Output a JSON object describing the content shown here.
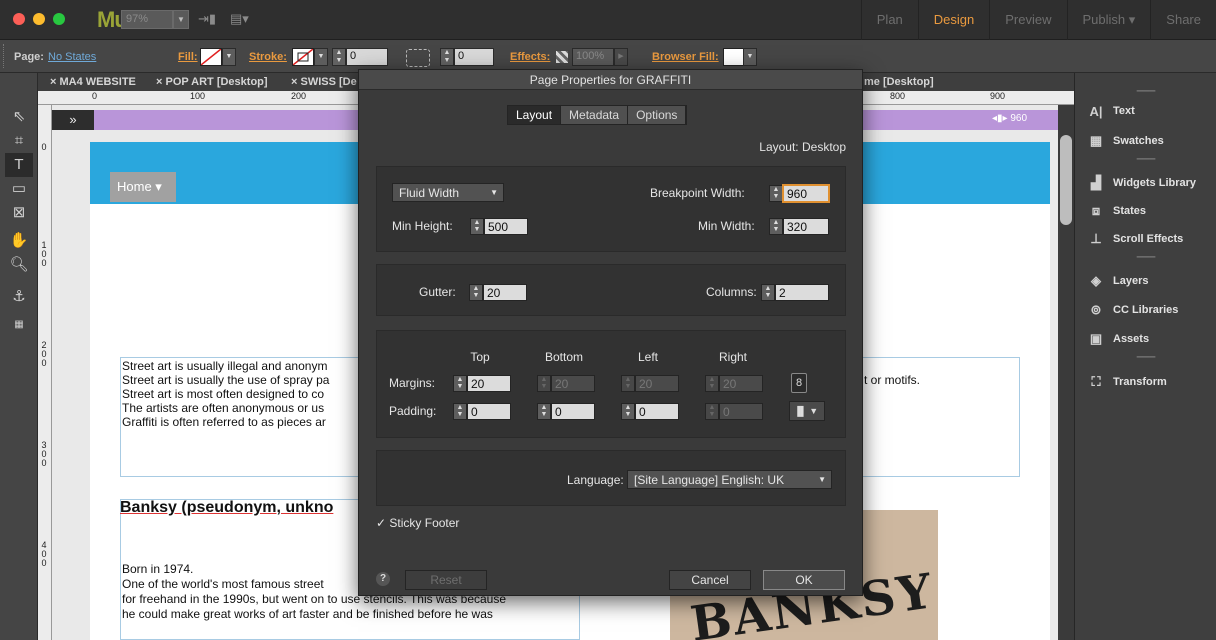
{
  "app": {
    "logo": "Mu",
    "zoom": "97%",
    "modes": [
      "Plan",
      "Design",
      "Preview",
      "Publish ▾",
      "Share"
    ]
  },
  "controlbar": {
    "page_label": "Page:",
    "page_state": "No States",
    "fill_label": "Fill:",
    "stroke_label": "Stroke:",
    "stroke_value": "0",
    "corner_value": "0",
    "effects_label": "Effects:",
    "effects_value": "100%",
    "browser_fill_label": "Browser Fill:"
  },
  "doc_tabs": [
    "× MA4 WEBSITE",
    "× POP ART [Desktop]",
    "× SWISS [De",
    "me [Desktop]"
  ],
  "ruler": {
    "h_ticks": [
      "0",
      "100",
      "200",
      "800",
      "900"
    ],
    "v_ticks": [
      "0",
      "1\n0\n0",
      "2\n0\n0",
      "3\n0\n0",
      "4\n0\n0"
    ]
  },
  "canvas": {
    "breakpoint_label": "◂▮▸ 960",
    "home_menu": "Home ▾",
    "paragraph_lines": [
      "Street art is usually illegal and anonym",
      "Street art is usually the use of spray pa",
      "Street art is most often designed to co",
      "The artists are often anonymous or us",
      "Graffiti is often referred to as pieces ar"
    ],
    "paragraph_right_fragment": "t or motifs.",
    "banksy_title": "Banksy (pseudonym, unkno",
    "banksy_lines": [
      "Born in 1974.",
      "One of the world's most famous street",
      "for freehand in the 1990s, but went on to use stencils. This was because",
      "he could make great works of art faster and be finished before he was"
    ],
    "image_text": "BANKSY"
  },
  "right_panel": {
    "items": [
      "Text",
      "Swatches",
      "Widgets Library",
      "States",
      "Scroll Effects",
      "Layers",
      "CC Libraries",
      "Assets",
      "Transform"
    ]
  },
  "dialog": {
    "title": "Page Properties for GRAFFITI",
    "tabs": [
      "Layout",
      "Metadata",
      "Options"
    ],
    "layout_label": "Layout: Desktop",
    "width_mode": "Fluid Width",
    "breakpoint_width_label": "Breakpoint Width:",
    "breakpoint_width": "960",
    "min_height_label": "Min Height:",
    "min_height": "500",
    "min_width_label": "Min Width:",
    "min_width": "320",
    "gutter_label": "Gutter:",
    "gutter": "20",
    "columns_label": "Columns:",
    "columns": "2",
    "col_top": "Top",
    "col_bottom": "Bottom",
    "col_left": "Left",
    "col_right": "Right",
    "margins_label": "Margins:",
    "margins": [
      "20",
      "20",
      "20",
      "20"
    ],
    "padding_label": "Padding:",
    "padding": [
      "0",
      "0",
      "0",
      "0"
    ],
    "language_label": "Language:",
    "language_value": "[Site Language] English: UK",
    "sticky_footer": "Sticky Footer",
    "reset": "Reset",
    "cancel": "Cancel",
    "ok": "OK"
  }
}
